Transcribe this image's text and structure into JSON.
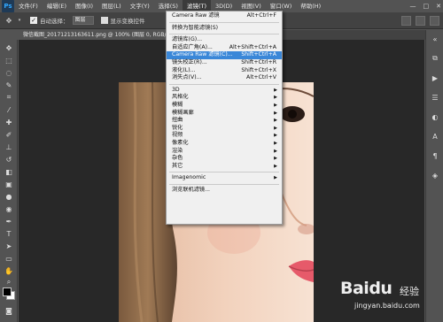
{
  "app": {
    "logo": "Ps"
  },
  "menubar": {
    "items": [
      "文件(F)",
      "编辑(E)",
      "图像(I)",
      "图层(L)",
      "文字(Y)",
      "选择(S)",
      "滤镜(T)",
      "3D(D)",
      "视图(V)",
      "窗口(W)",
      "帮助(H)"
    ],
    "active_index": 6,
    "window_controls": [
      "—",
      "□",
      "✕"
    ]
  },
  "options_bar": {
    "auto_select_label": "自动选择：",
    "auto_select_value": "图层",
    "show_transform_label": "显示变换控件"
  },
  "document": {
    "tab_title": "微信截图_20171213163611.png @ 100% (图层 0, RGB/8#)"
  },
  "filter_menu": {
    "items": [
      {
        "label": "Camera Raw 滤镜",
        "shortcut": "Alt+Ctrl+F",
        "submenu": false,
        "highlighted": false
      },
      {
        "separator": true
      },
      {
        "label": "转换为智能滤镜(S)",
        "shortcut": "",
        "submenu": false,
        "highlighted": false
      },
      {
        "separator": true
      },
      {
        "label": "滤镜库(G)...",
        "shortcut": "",
        "submenu": false,
        "highlighted": false
      },
      {
        "label": "自适应广角(A)...",
        "shortcut": "Alt+Shift+Ctrl+A",
        "submenu": false,
        "highlighted": false
      },
      {
        "label": "Camera Raw 滤镜(C)...",
        "shortcut": "Shift+Ctrl+A",
        "submenu": false,
        "highlighted": true
      },
      {
        "label": "镜头校正(R)...",
        "shortcut": "Shift+Ctrl+R",
        "submenu": false,
        "highlighted": false
      },
      {
        "label": "液化(L)...",
        "shortcut": "Shift+Ctrl+X",
        "submenu": false,
        "highlighted": false
      },
      {
        "label": "消失点(V)...",
        "shortcut": "Alt+Ctrl+V",
        "submenu": false,
        "highlighted": false
      },
      {
        "separator": true
      },
      {
        "label": "3D",
        "shortcut": "",
        "submenu": true,
        "highlighted": false
      },
      {
        "label": "风格化",
        "shortcut": "",
        "submenu": true,
        "highlighted": false
      },
      {
        "label": "模糊",
        "shortcut": "",
        "submenu": true,
        "highlighted": false
      },
      {
        "label": "模糊画廊",
        "shortcut": "",
        "submenu": true,
        "highlighted": false
      },
      {
        "label": "扭曲",
        "shortcut": "",
        "submenu": true,
        "highlighted": false
      },
      {
        "label": "锐化",
        "shortcut": "",
        "submenu": true,
        "highlighted": false
      },
      {
        "label": "视频",
        "shortcut": "",
        "submenu": true,
        "highlighted": false
      },
      {
        "label": "像素化",
        "shortcut": "",
        "submenu": true,
        "highlighted": false
      },
      {
        "label": "渲染",
        "shortcut": "",
        "submenu": true,
        "highlighted": false
      },
      {
        "label": "杂色",
        "shortcut": "",
        "submenu": true,
        "highlighted": false
      },
      {
        "label": "其它",
        "shortcut": "",
        "submenu": true,
        "highlighted": false
      },
      {
        "separator": true
      },
      {
        "label": "Imagenomic",
        "shortcut": "",
        "submenu": true,
        "highlighted": false
      },
      {
        "separator": true
      },
      {
        "label": "浏览联机滤镜...",
        "shortcut": "",
        "submenu": false,
        "highlighted": false
      }
    ]
  },
  "watermark": {
    "brand": "Baidu",
    "brand_cn": "经验",
    "url": "jingyan.baidu.com"
  },
  "colors": {
    "highlight": "#3a87d8",
    "menu_bg": "#f0f0f0",
    "workspace_bg": "#282828",
    "chrome_bg": "#535353"
  }
}
